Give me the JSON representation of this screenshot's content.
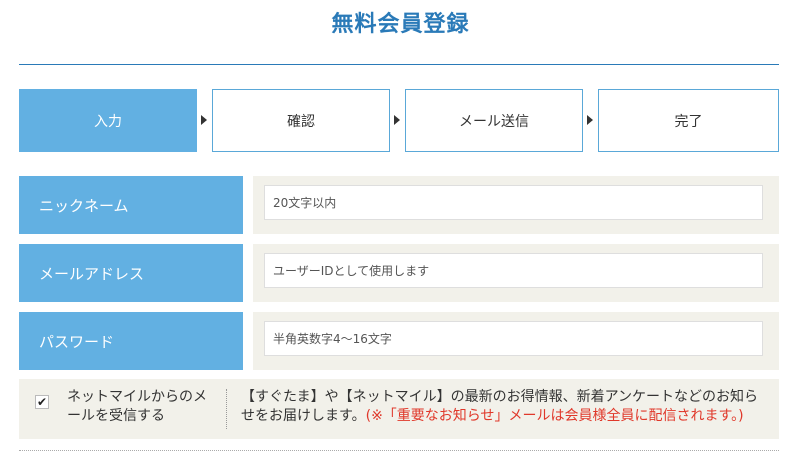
{
  "page": {
    "title": "無料会員登録"
  },
  "steps": [
    {
      "label": "入力",
      "active": true
    },
    {
      "label": "確認",
      "active": false
    },
    {
      "label": "メール送信",
      "active": false
    },
    {
      "label": "完了",
      "active": false
    }
  ],
  "form": {
    "nickname": {
      "label": "ニックネーム",
      "placeholder": "20文字以内",
      "value": ""
    },
    "email": {
      "label": "メールアドレス",
      "placeholder": "ユーザーIDとして使用します",
      "value": ""
    },
    "password": {
      "label": "パスワード",
      "placeholder": "半角英数字4～16文字",
      "value": ""
    }
  },
  "optin": {
    "checked": true,
    "check_mark": "✔",
    "label": "ネットマイルからのメールを受信する",
    "description": "【すぐたま】や【ネットマイル】の最新のお得情報、新着アンケートなどのお知らせをお届けします。",
    "note": "(※「重要なお知らせ」メールは会員様全員に配信されます。)"
  },
  "colors": {
    "accent": "#62b0e2",
    "title": "#2a7ab8",
    "field_bg": "#f2f1ea",
    "note": "#e0382a"
  }
}
